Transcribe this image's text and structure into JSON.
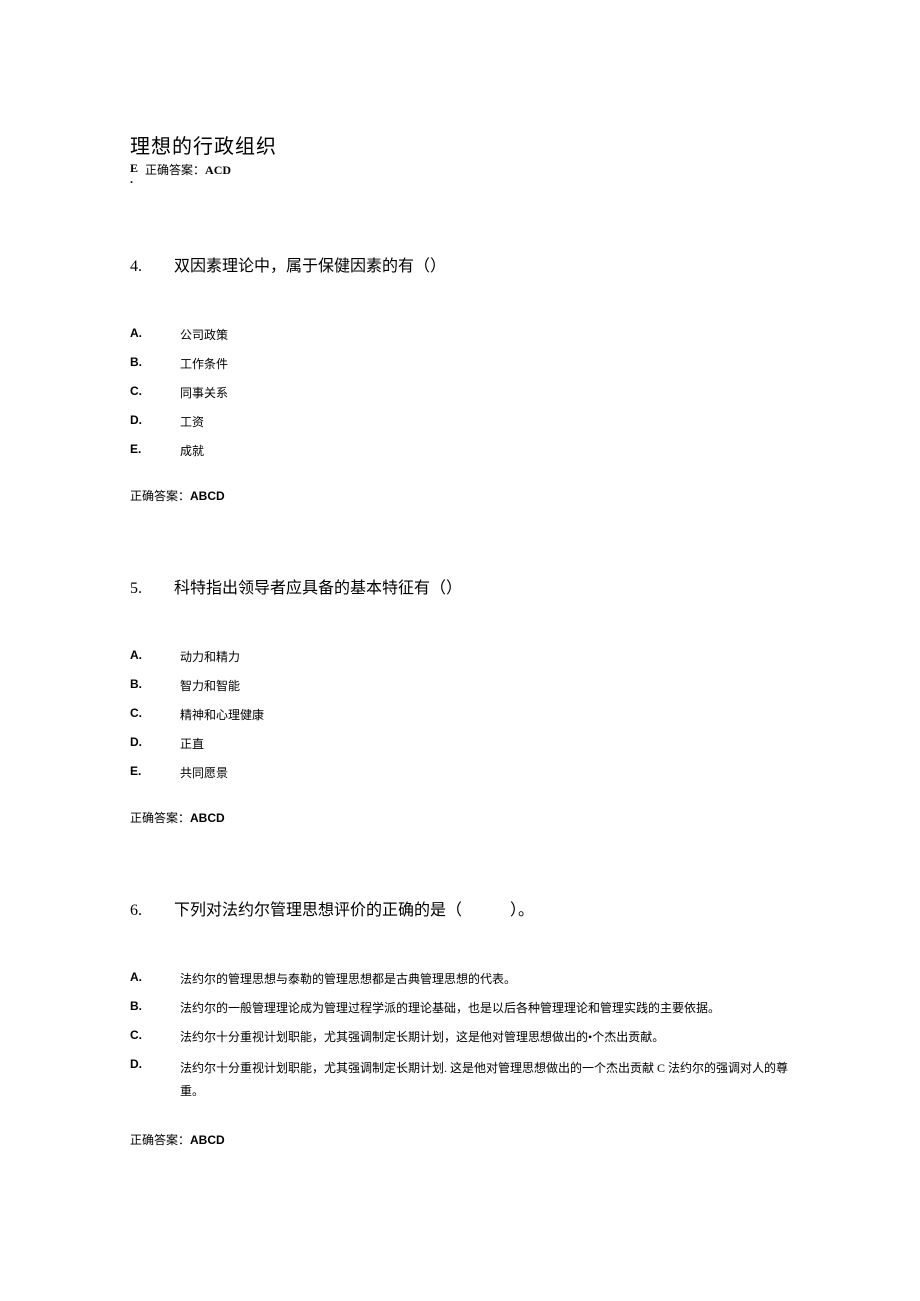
{
  "header": {
    "title": "理想的行政组织",
    "prefix": "E",
    "dot": ".",
    "answer_label": "正确答案：",
    "answer_value": "ACD"
  },
  "questions": [
    {
      "num": "4.",
      "text": "双因素理论中，属于保健因素的有（）",
      "options": [
        {
          "letter": "A.",
          "text": "公司政策"
        },
        {
          "letter": "B.",
          "text": "工作条件"
        },
        {
          "letter": "C.",
          "text": "同事关系"
        },
        {
          "letter": "D.",
          "text": "工资"
        },
        {
          "letter": "E.",
          "text": "成就"
        }
      ],
      "answer_label": "正确答案：",
      "answer_value": "ABCD"
    },
    {
      "num": "5.",
      "text": "科特指出领导者应具备的基本特征有（）",
      "options": [
        {
          "letter": "A.",
          "text": "动力和精力"
        },
        {
          "letter": "B.",
          "text": "智力和智能"
        },
        {
          "letter": "C.",
          "text": "精神和心理健康"
        },
        {
          "letter": "D.",
          "text": "正直"
        },
        {
          "letter": "E.",
          "text": "共同愿景"
        }
      ],
      "answer_label": "正确答案：",
      "answer_value": "ABCD"
    },
    {
      "num": "6.",
      "text": "下列对法约尔管理思想评价的正确的是（　　　）。",
      "options": [
        {
          "letter": "A.",
          "text": "法约尔的管理思想与泰勒的管理思想都是古典管理思想的代表。"
        },
        {
          "letter": "B.",
          "text": "法约尔的一般管理理论成为管理过程学派的理论基础，也是以后各种管理理论和管理实践的主要依据。"
        },
        {
          "letter": "C.",
          "text": "法约尔十分重视计划职能，尤其强调制定长期计划，这是他对管理思想做出的•个杰出贡献。"
        },
        {
          "letter": "D.",
          "text": "法约尔十分重视计划职能，尤其强调制定长期计划. 这是他对管理思想做出的一个杰出贡献 C 法约尔的强调对人的尊重。"
        }
      ],
      "answer_label": "正确答案：",
      "answer_value": "ABCD"
    }
  ]
}
